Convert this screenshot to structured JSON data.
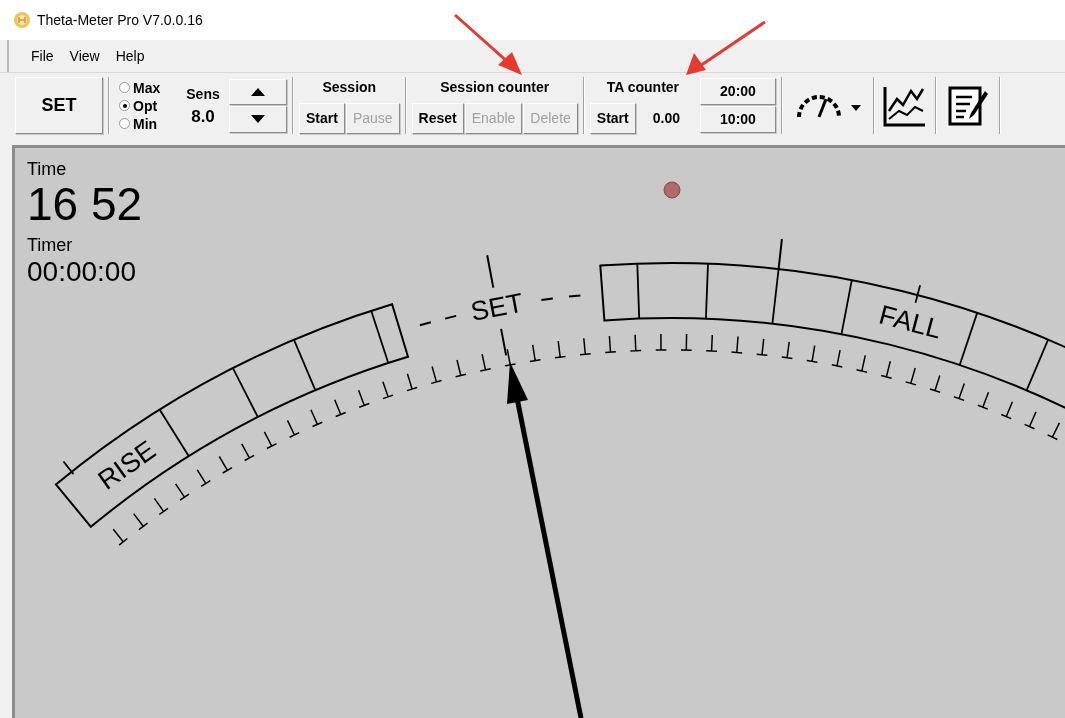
{
  "window": {
    "title": "Theta-Meter Pro V7.0.0.16"
  },
  "menu": [
    "File",
    "View",
    "Help"
  ],
  "toolbar": {
    "set_button": "SET",
    "sensitivity_modes": [
      {
        "label": "Max",
        "selected": false
      },
      {
        "label": "Opt",
        "selected": true
      },
      {
        "label": "Min",
        "selected": false
      }
    ],
    "sens_label": "Sens",
    "sens_value": "8.0",
    "session": {
      "title": "Session",
      "buttons": [
        {
          "label": "Start",
          "disabled": false
        },
        {
          "label": "Pause",
          "disabled": true
        }
      ]
    },
    "session_counter": {
      "title": "Session counter",
      "buttons": [
        {
          "label": "Reset",
          "disabled": false
        },
        {
          "label": "Enable",
          "disabled": true
        },
        {
          "label": "Delete",
          "disabled": true
        }
      ]
    },
    "ta_counter": {
      "title": "TA counter",
      "buttons": [
        {
          "label": "Start",
          "disabled": false
        }
      ],
      "value": "0.00"
    },
    "time_presets": [
      "20:00",
      "10:00"
    ]
  },
  "meter": {
    "time_label": "Time",
    "time": "16 52",
    "timer_label": "Timer",
    "timer": "00:00:00",
    "scale": {
      "set_label": "SET",
      "rise_label": "RISE",
      "fall_label": "FALL"
    }
  }
}
